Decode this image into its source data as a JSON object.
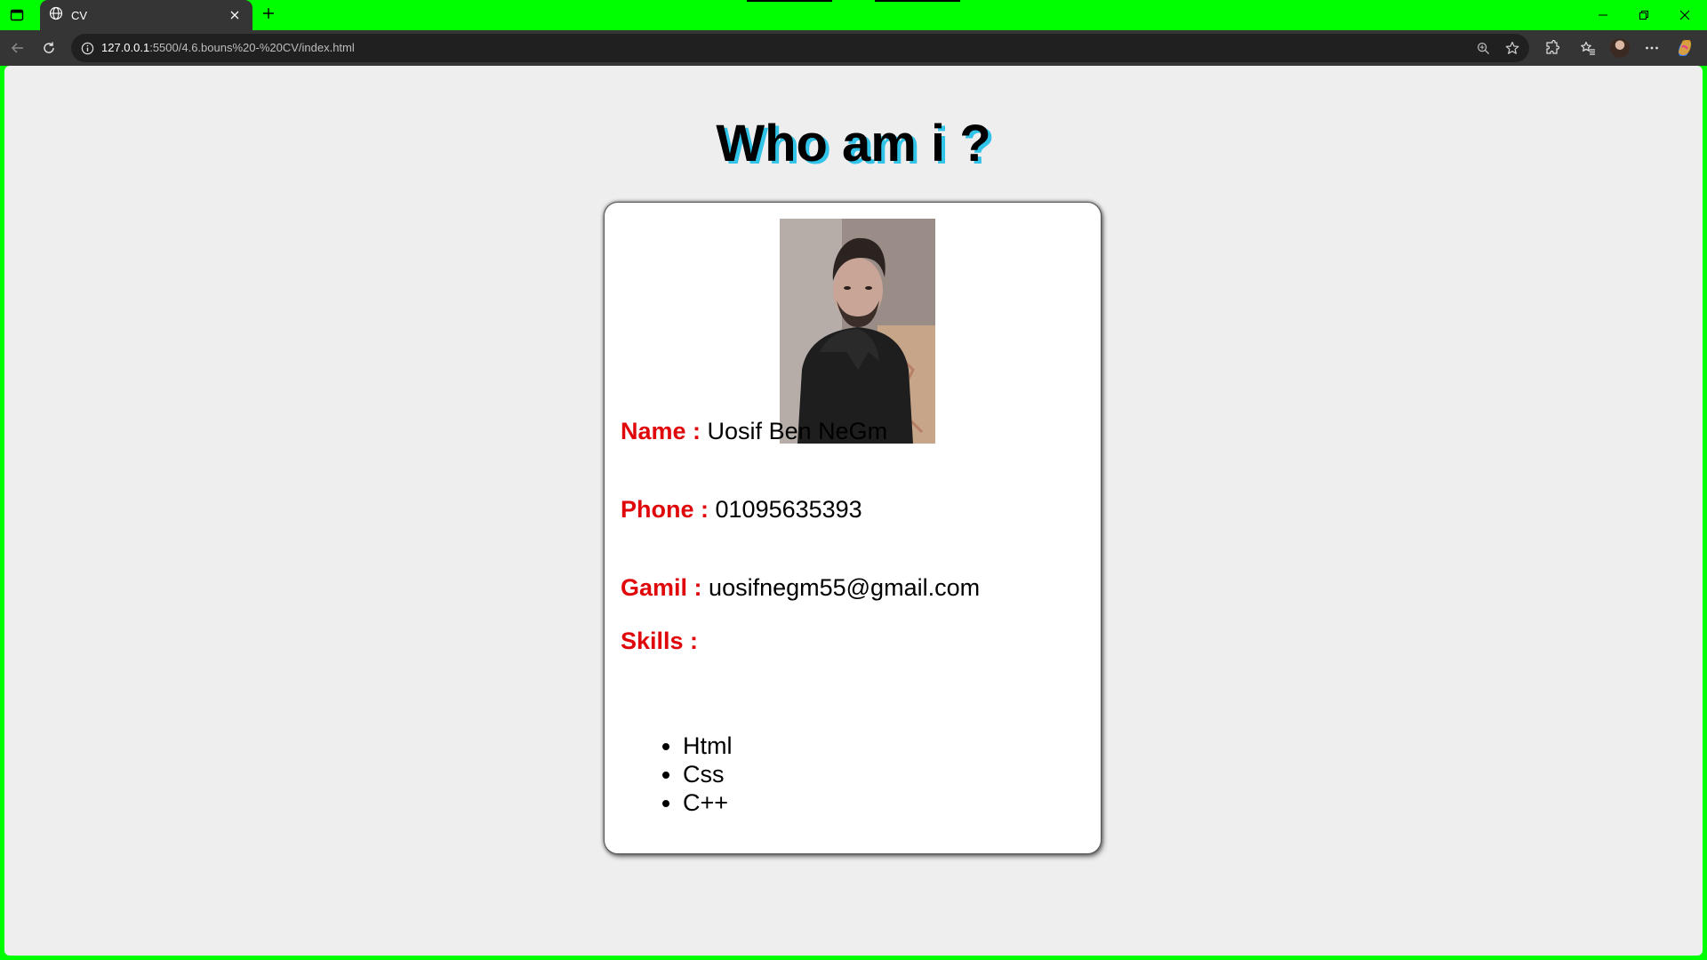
{
  "browser": {
    "tab": {
      "title": "CV"
    },
    "address": {
      "host": "127.0.0.1",
      "path": ":5500/4.6.bouns%20-%20CV/index.html"
    }
  },
  "page": {
    "heading": "Who am i ?",
    "card": {
      "name": {
        "label": "Name :",
        "value": "Uosif Ben NeGm"
      },
      "phone": {
        "label": "Phone :",
        "value": "01095635393"
      },
      "email": {
        "label": "Gamil :",
        "value": "uosifnegm55@gmail.com"
      },
      "skills": {
        "label": "Skills :",
        "items": [
          "Html",
          "Css",
          "C++"
        ]
      }
    }
  },
  "colors": {
    "tabbar_bg": "#00ff00",
    "label_red": "#e0070b",
    "heading_shadow": "#31c4e8",
    "page_bg": "#eeeeee"
  },
  "icons": [
    "sidebar-toggle-icon",
    "globe-icon",
    "close-icon",
    "plus-icon",
    "minimize-icon",
    "restore-icon",
    "back-icon",
    "refresh-icon",
    "info-icon",
    "zoom-icon",
    "star-icon",
    "extensions-icon",
    "favorites-icon",
    "more-icon",
    "copilot-icon"
  ]
}
